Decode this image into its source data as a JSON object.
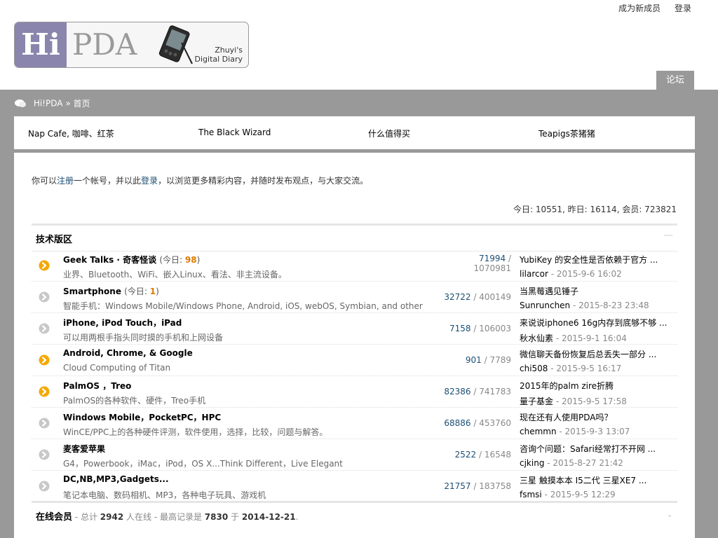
{
  "header": {
    "register_link": "成为新成员",
    "login_link": "登录",
    "logo_hi": "Hi",
    "logo_pda": "PDA",
    "logo_sub1": "Zhuyi's",
    "logo_sub2": "Digital Diary",
    "nav_tab": "论坛"
  },
  "breadcrumb": {
    "home": "Hi!PDA",
    "sep": "»",
    "current": "首页"
  },
  "quick_links": [
    "Nap Cafe, 咖啡、红茶",
    "The Black Wizard",
    "什么值得买",
    "Teapigs茶猪猪"
  ],
  "notice": {
    "prefix": "你可以",
    "register": "注册",
    "middle": "一个帐号，并以此",
    "login": "登录",
    "suffix": "，以浏览更多精彩内容，并随时发布观点，与大家交流。"
  },
  "stats": "今日: 10551, 昨日: 16114, 会员: 723821",
  "section": {
    "title": "技术版区",
    "toggle": "—"
  },
  "forums": [
    {
      "name": "Geek Talks · 奇客怪谈",
      "today_label": "(今日: ",
      "today_count": "98",
      "today_close": ")",
      "desc": "业界、Bluetooth、WiFi、嵌入Linux、看法、非主流设备。",
      "threads": "71994",
      "posts": "1070981",
      "last_title": "YubiKey 的安全性是否依赖于官方 ...",
      "last_user": "lilarcor",
      "last_time": "2015-9-6 16:02",
      "has_new": true
    },
    {
      "name": "Smartphone",
      "today_label": "(今日: ",
      "today_count": "1",
      "today_close": ")",
      "desc": "智能手机：Windows Mobile/Windows Phone, Android, iOS, webOS, Symbian, and other",
      "threads": "32722",
      "posts": "400149",
      "last_title": "当黑莓遇见锤子",
      "last_user": "Sunrunchen",
      "last_time": "2015-8-23 23:48",
      "has_new": false
    },
    {
      "name": "iPhone, iPod Touch，iPad",
      "today_label": "",
      "today_count": "",
      "today_close": "",
      "desc": "可以用两根手指头同时摸的手机和上网设备",
      "threads": "7158",
      "posts": "106003",
      "last_title": "来说说iphone6 16g内存到底够不够 ...",
      "last_user": "秋水仙素",
      "last_time": "2015-9-1 16:04",
      "has_new": false
    },
    {
      "name": "Android, Chrome, & Google",
      "today_label": "",
      "today_count": "",
      "today_close": "",
      "desc": "Cloud Computing of Titan",
      "threads": "901",
      "posts": "7789",
      "last_title": "微信聊天备份恢复后总丢失一部分 ...",
      "last_user": "chi508",
      "last_time": "2015-9-5 16:17",
      "has_new": true
    },
    {
      "name": "PalmOS ，Treo",
      "today_label": "",
      "today_count": "",
      "today_close": "",
      "desc": "PalmOS的各种软件、硬件，Treo手机",
      "threads": "82386",
      "posts": "741783",
      "last_title": "2015年的palm zire折腾",
      "last_user": "量子基金",
      "last_time": "2015-9-5 17:58",
      "has_new": true
    },
    {
      "name": "Windows Mobile，PocketPC，HPC",
      "today_label": "",
      "today_count": "",
      "today_close": "",
      "desc": "WinCE/PPC上的各种硬件评测，软件使用，选择，比较，问题与解答。",
      "threads": "68886",
      "posts": "453760",
      "last_title": "现在还有人使用PDA吗？",
      "last_user": "chemmn",
      "last_time": "2015-9-3 13:07",
      "has_new": false
    },
    {
      "name": "麦客爱苹果",
      "today_label": "",
      "today_count": "",
      "today_close": "",
      "desc": "G4，Powerbook，iMac，iPod，OS X...Think Different，Live Elegant",
      "threads": "2522",
      "posts": "16548",
      "last_title": "咨询个问题：Safari经常打不开网 ...",
      "last_user": "cjking",
      "last_time": "2015-8-27 21:42",
      "has_new": false
    },
    {
      "name": "DC,NB,MP3,Gadgets...",
      "today_label": "",
      "today_count": "",
      "today_close": "",
      "desc": "笔记本电脑、数码相机、MP3，各种电子玩具、游戏机",
      "threads": "21757",
      "posts": "183758",
      "last_title": "三星 触摸本本 I5二代 三星XE7 ...",
      "last_user": "fsmsi",
      "last_time": "2015-9-5 12:29",
      "has_new": false
    }
  ],
  "online": {
    "label": "在线会员",
    "text1": " - 总计 ",
    "total": "2942",
    "text2": " 人在线 - 最高记录是 ",
    "record": "7830",
    "text3": " 于 ",
    "record_date": "2014-12-21",
    "text4": ".",
    "toggle": "⌄"
  },
  "colors": {
    "new_icon": "#f5a800",
    "old_icon": "#c8c8c8",
    "link": "#1c4f73",
    "frame_gray": "#999999"
  }
}
